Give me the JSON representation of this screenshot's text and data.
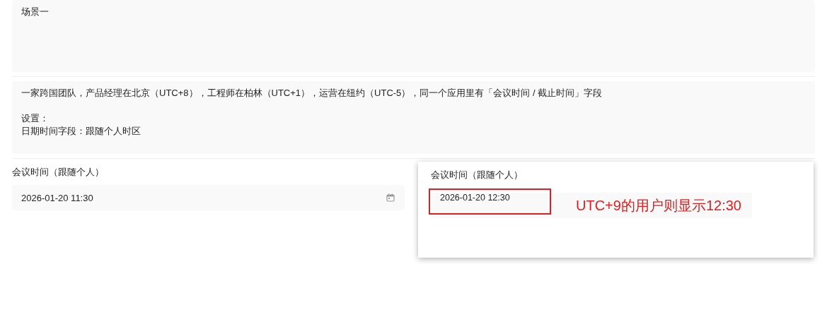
{
  "scenario": {
    "title": "场景一"
  },
  "description": {
    "lines": [
      "一家跨国团队，产品经理在北京（UTC+8），工程师在柏林（UTC+1），运营在纽约（UTC-5），同一个应用里有「会议时间 / 截止时间」字段",
      "设置：",
      "日期时间字段：跟随个人时区"
    ]
  },
  "field": {
    "label": "会议时间（跟随个人）",
    "value": "2026-01-20 11:30"
  },
  "popup": {
    "label": "会议时间（跟随个人）",
    "value": "2026-01-20 12:30",
    "annotation": "UTC+9的用户则显示12:30"
  }
}
